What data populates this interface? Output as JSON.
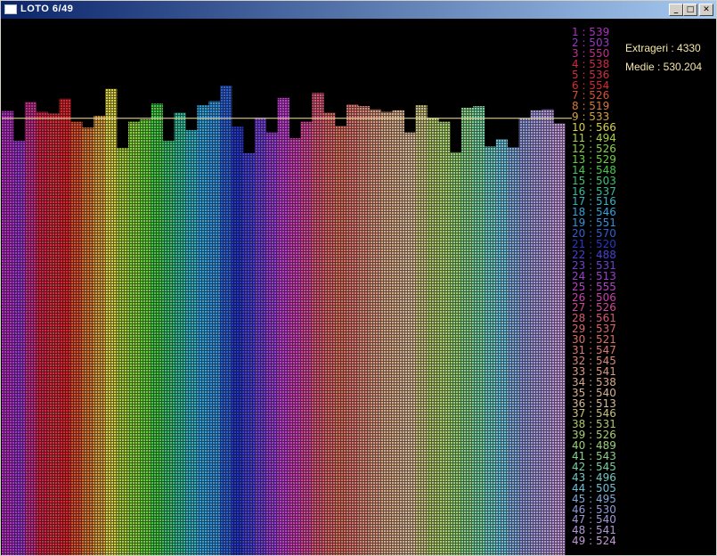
{
  "window": {
    "title": "LOTO 6/49",
    "min_label": "_",
    "max_label": "□",
    "close_label": "✕"
  },
  "stats": {
    "extrageri": "Extrageri : 4330",
    "medie": "Medie : 530.204"
  },
  "colors": {
    "mean_line": "#f5e6a8",
    "stats_text": "#f5e6a8"
  },
  "chart_data": {
    "type": "bar",
    "title": "",
    "xlabel": "",
    "ylabel": "",
    "mean": 530.204,
    "draws": 4330,
    "ylim": [
      0,
      650
    ],
    "grid": false,
    "categories": [
      1,
      2,
      3,
      4,
      5,
      6,
      7,
      8,
      9,
      10,
      11,
      12,
      13,
      14,
      15,
      16,
      17,
      18,
      19,
      20,
      21,
      22,
      23,
      24,
      25,
      26,
      27,
      28,
      29,
      30,
      31,
      32,
      33,
      34,
      35,
      36,
      37,
      38,
      39,
      40,
      41,
      42,
      43,
      44,
      45,
      46,
      47,
      48,
      49
    ],
    "values": [
      539,
      503,
      550,
      538,
      536,
      554,
      526,
      519,
      533,
      566,
      494,
      526,
      529,
      548,
      503,
      537,
      516,
      546,
      551,
      570,
      520,
      488,
      531,
      513,
      555,
      506,
      526,
      561,
      537,
      521,
      547,
      545,
      541,
      538,
      540,
      513,
      546,
      531,
      526,
      489,
      543,
      545,
      496,
      505,
      495,
      530,
      540,
      541,
      524
    ],
    "colors": [
      "#b030c0",
      "#9838c8",
      "#c03088",
      "#d02848",
      "#d03040",
      "#d82830",
      "#d85030",
      "#d87838",
      "#d8a040",
      "#d8d048",
      "#a8d040",
      "#88d040",
      "#68d040",
      "#48c848",
      "#40c070",
      "#38b898",
      "#38b0c0",
      "#38a0d8",
      "#3890d8",
      "#3060d0",
      "#2838c8",
      "#4840d0",
      "#7040d0",
      "#9840d0",
      "#b840c8",
      "#c840b0",
      "#d04898",
      "#d85878",
      "#d86868",
      "#d87060",
      "#d87870",
      "#d88878",
      "#d89880",
      "#d8a888",
      "#d8b090",
      "#d8b898",
      "#c8c080",
      "#b0c870",
      "#a8d070",
      "#98d078",
      "#88d088",
      "#78d0a0",
      "#70c8c0",
      "#70c0d8",
      "#80a8d8",
      "#9098d8",
      "#a098d8",
      "#b098d8",
      "#c098d8"
    ],
    "legend": [
      "1 : 539",
      "2 : 503",
      "3 : 550",
      "4 : 538",
      "5 : 536",
      "6 : 554",
      "7 : 526",
      "8 : 519",
      "9 : 533",
      "10 : 566",
      "11 : 494",
      "12 : 526",
      "13 : 529",
      "14 : 548",
      "15 : 503",
      "16 : 537",
      "17 : 516",
      "18 : 546",
      "19 : 551",
      "20 : 570",
      "21 : 520",
      "22 : 488",
      "23 : 531",
      "24 : 513",
      "25 : 555",
      "26 : 506",
      "27 : 526",
      "28 : 561",
      "29 : 537",
      "30 : 521",
      "31 : 547",
      "32 : 545",
      "33 : 541",
      "34 : 538",
      "35 : 540",
      "36 : 513",
      "37 : 546",
      "38 : 531",
      "39 : 526",
      "40 : 489",
      "41 : 543",
      "42 : 545",
      "43 : 496",
      "44 : 505",
      "45 : 495",
      "46 : 530",
      "47 : 540",
      "48 : 541",
      "49 : 524"
    ]
  }
}
